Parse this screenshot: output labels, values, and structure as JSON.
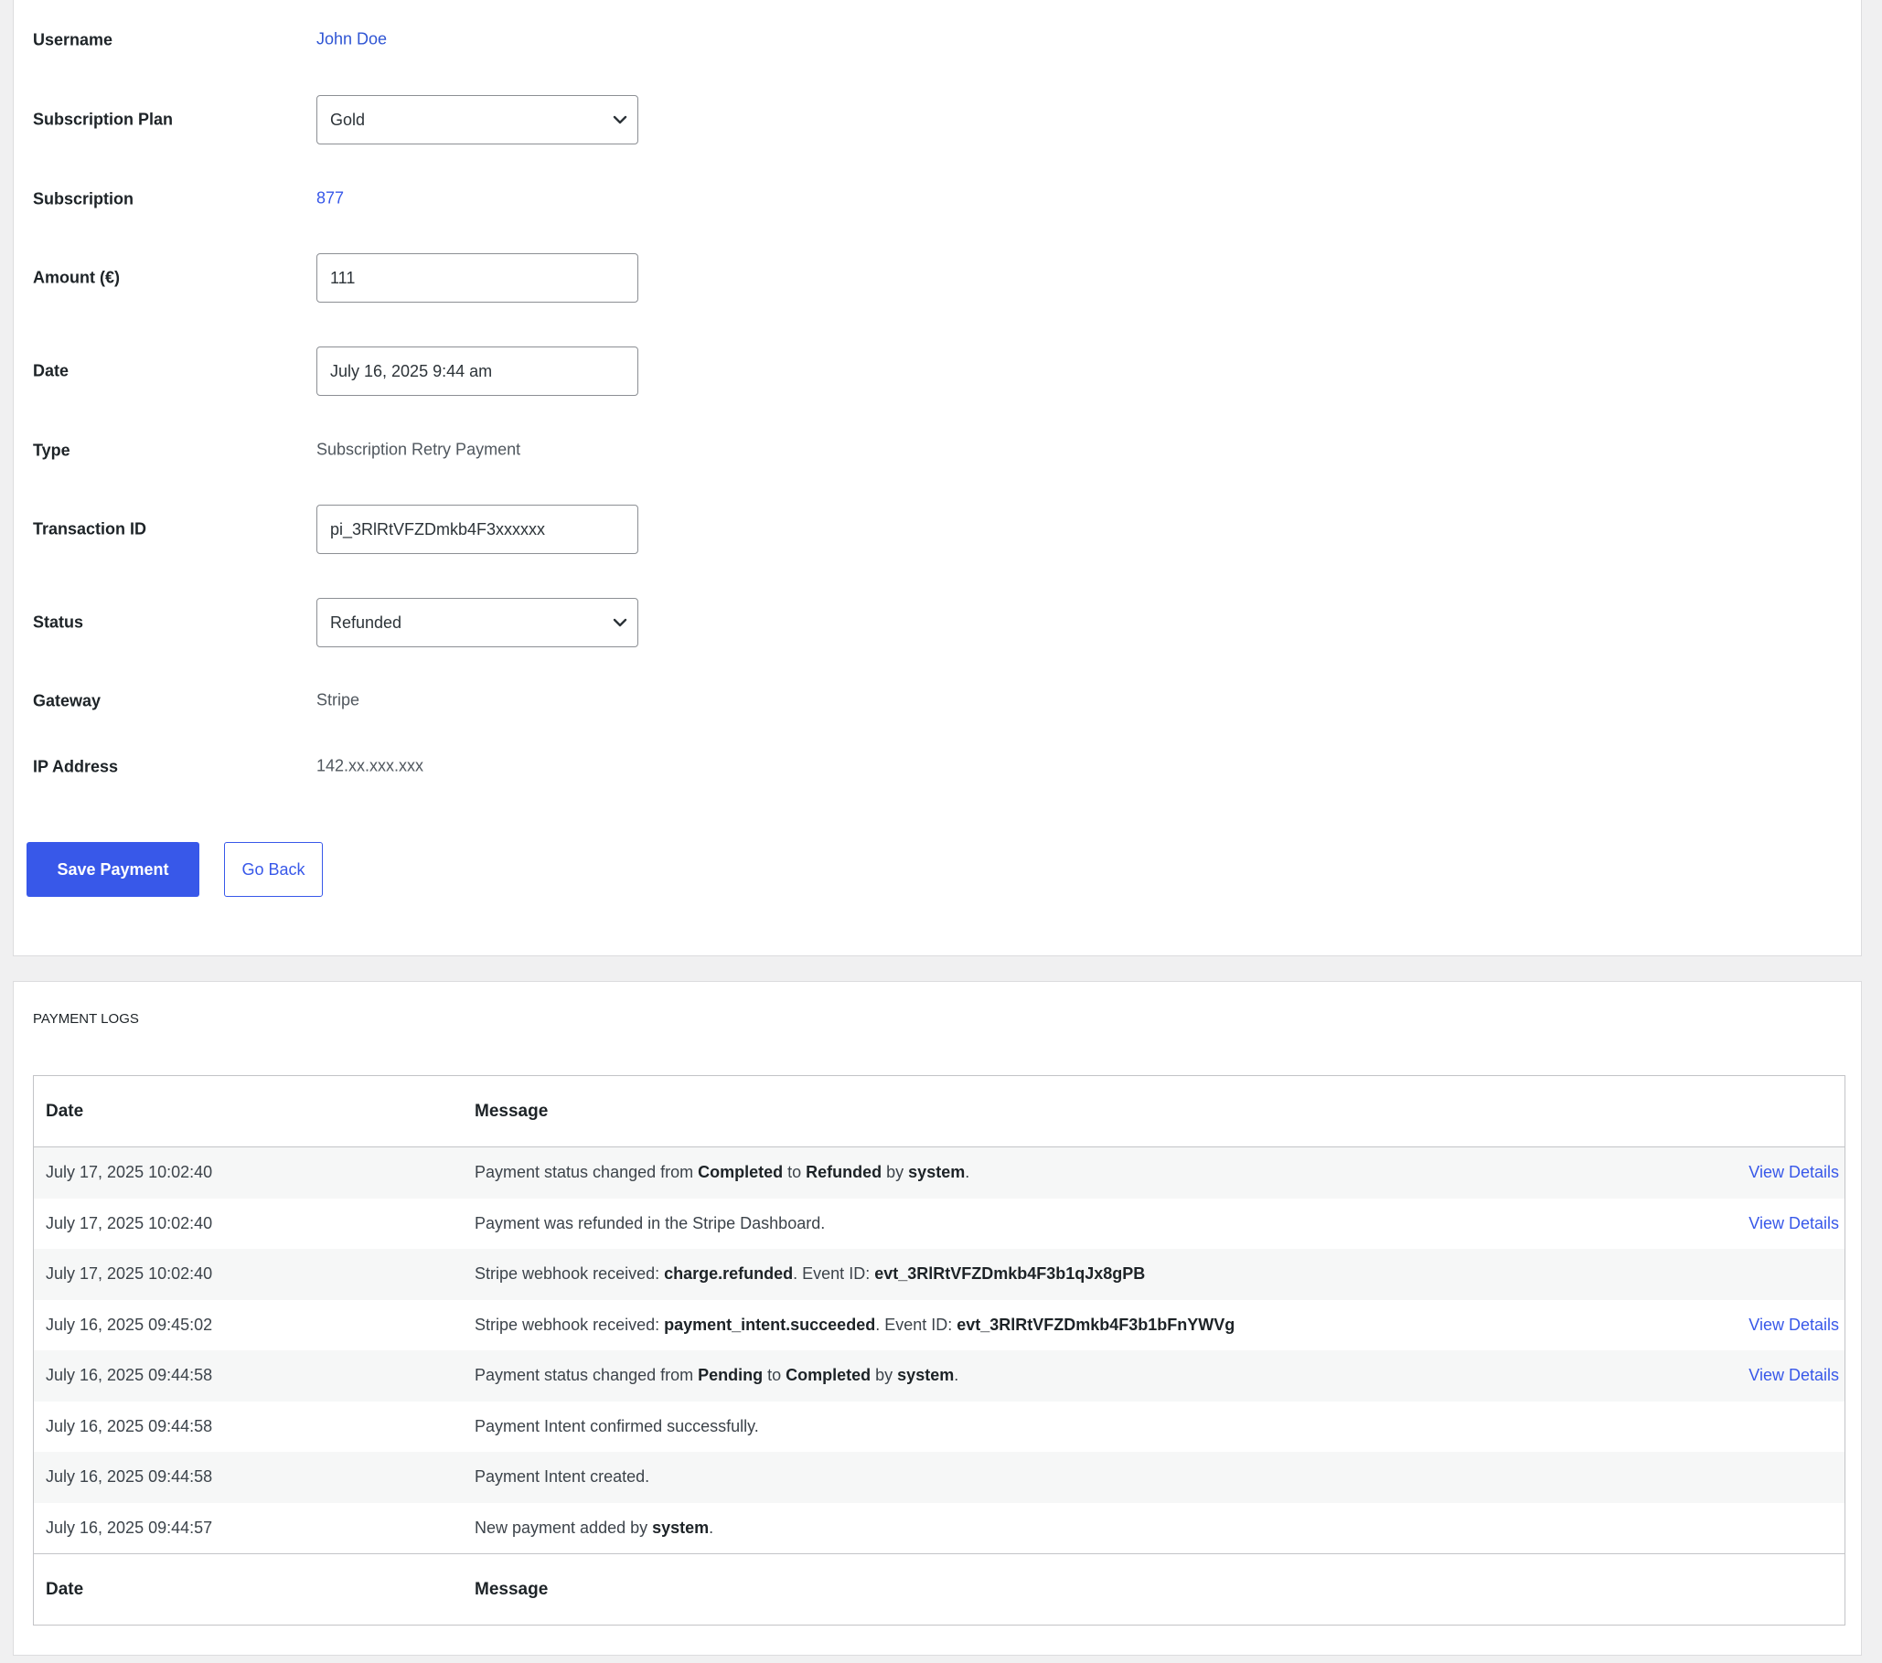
{
  "form": {
    "username": {
      "label": "Username",
      "value": "John Doe"
    },
    "plan": {
      "label": "Subscription Plan",
      "value": "Gold"
    },
    "subscription": {
      "label": "Subscription",
      "value": "877"
    },
    "amount": {
      "label": "Amount (€)",
      "value": "111"
    },
    "date": {
      "label": "Date",
      "value": "July 16, 2025 9:44 am"
    },
    "type": {
      "label": "Type",
      "value": "Subscription Retry Payment"
    },
    "transaction": {
      "label": "Transaction ID",
      "value": "pi_3RlRtVFZDmkb4F3xxxxxx"
    },
    "status": {
      "label": "Status",
      "value": "Refunded"
    },
    "gateway": {
      "label": "Gateway",
      "value": "Stripe"
    },
    "ip": {
      "label": "IP Address",
      "value": "142.xx.xxx.xxx"
    },
    "save_label": "Save Payment",
    "back_label": "Go Back"
  },
  "logs": {
    "title": "PAYMENT LOGS",
    "header": {
      "date": "Date",
      "message": "Message"
    },
    "footer": {
      "date": "Date",
      "message": "Message"
    },
    "view_details_label": "View Details",
    "rows": [
      {
        "date": "July 17, 2025 10:02:40",
        "message": [
          "Payment status changed from ",
          {
            "b": "Completed"
          },
          " to ",
          {
            "b": "Refunded"
          },
          " by ",
          {
            "b": "system"
          },
          "."
        ],
        "view_details": true
      },
      {
        "date": "July 17, 2025 10:02:40",
        "message": [
          "Payment was refunded in the Stripe Dashboard."
        ],
        "view_details": true
      },
      {
        "date": "July 17, 2025 10:02:40",
        "message": [
          "Stripe webhook received: ",
          {
            "b": "charge.refunded"
          },
          ". Event ID: ",
          {
            "b": "evt_3RlRtVFZDmkb4F3b1qJx8gPB"
          }
        ],
        "view_details": false
      },
      {
        "date": "July 16, 2025 09:45:02",
        "message": [
          "Stripe webhook received: ",
          {
            "b": "payment_intent.succeeded"
          },
          ". Event ID: ",
          {
            "b": "evt_3RlRtVFZDmkb4F3b1bFnYWVg"
          }
        ],
        "view_details": true
      },
      {
        "date": "July 16, 2025 09:44:58",
        "message": [
          "Payment status changed from ",
          {
            "b": "Pending"
          },
          " to ",
          {
            "b": "Completed"
          },
          " by ",
          {
            "b": "system"
          },
          "."
        ],
        "view_details": true
      },
      {
        "date": "July 16, 2025 09:44:58",
        "message": [
          "Payment Intent confirmed successfully."
        ],
        "view_details": false
      },
      {
        "date": "July 16, 2025 09:44:58",
        "message": [
          "Payment Intent created."
        ],
        "view_details": false
      },
      {
        "date": "July 16, 2025 09:44:57",
        "message": [
          "New payment added by ",
          {
            "b": "system"
          },
          "."
        ],
        "view_details": false
      }
    ]
  },
  "colors": {
    "accent": "#3858e9",
    "background": "#f0f0f1"
  },
  "icons": {
    "select_arrow": "chevron-down-icon"
  }
}
